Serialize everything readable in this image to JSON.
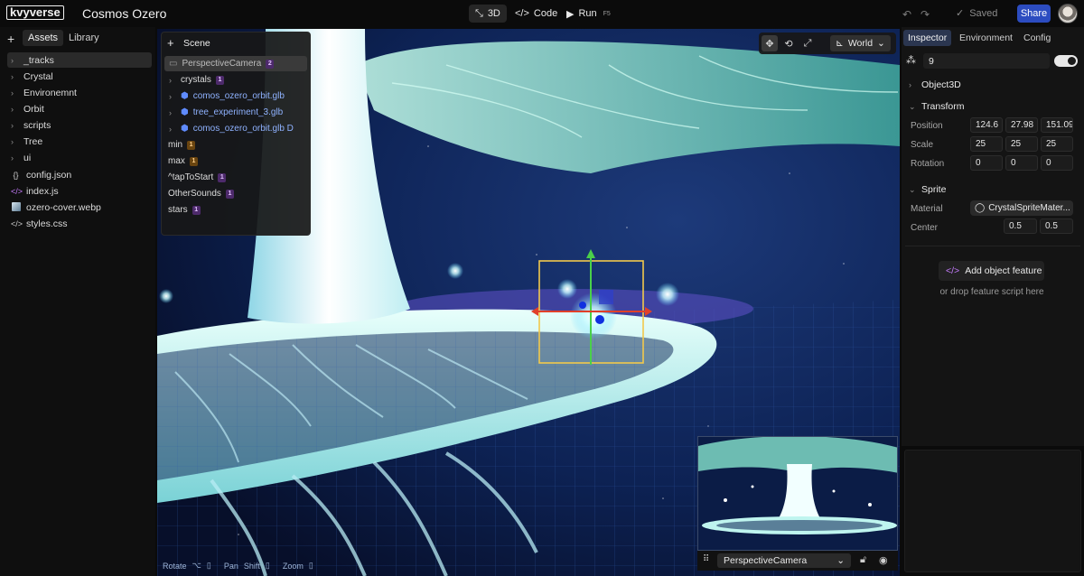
{
  "app": {
    "logo": "kvyverse",
    "project_title": "Cosmos Ozero"
  },
  "toolbar": {
    "mode_3d": "3D",
    "mode_code": "Code",
    "run": "Run",
    "run_shortcut": "F5",
    "saved": "Saved",
    "share": "Share"
  },
  "sidebar": {
    "tabs": [
      "Assets",
      "Library"
    ],
    "items": [
      {
        "label": "_tracks",
        "type": "folder"
      },
      {
        "label": "Crystal",
        "type": "folder"
      },
      {
        "label": "Environemnt",
        "type": "folder"
      },
      {
        "label": "Orbit",
        "type": "folder"
      },
      {
        "label": "scripts",
        "type": "folder"
      },
      {
        "label": "Tree",
        "type": "folder"
      },
      {
        "label": "ui",
        "type": "folder"
      },
      {
        "label": "config.json",
        "type": "json"
      },
      {
        "label": "index.js",
        "type": "js"
      },
      {
        "label": "ozero-cover.webp",
        "type": "image"
      },
      {
        "label": "styles.css",
        "type": "css"
      }
    ]
  },
  "scene": {
    "title": "Scene",
    "items": [
      {
        "label": "PerspectiveCamera",
        "badge": "2"
      },
      {
        "label": "crystals",
        "badge": "1"
      },
      {
        "label": "comos_ozero_orbit.glb"
      },
      {
        "label": "tree_experiment_3.glb"
      },
      {
        "label": "comos_ozero_orbit.glb D"
      },
      {
        "label": "min",
        "badge": "1"
      },
      {
        "label": "max",
        "badge": "1"
      },
      {
        "label": "^tapToStart",
        "badge": "1"
      },
      {
        "label": "OtherSounds",
        "badge": "1"
      },
      {
        "label": "stars",
        "badge": "1"
      }
    ]
  },
  "viewport": {
    "space": "World",
    "hints": {
      "rotate": "Rotate",
      "pan": "Pan",
      "pan_key": "Shift",
      "zoom": "Zoom"
    },
    "preview_camera": "PerspectiveCamera"
  },
  "inspector": {
    "tabs": [
      "Inspector",
      "Environment",
      "Config"
    ],
    "object_name": "9",
    "sections": {
      "object3d": "Object3D",
      "transform": "Transform",
      "sprite": "Sprite"
    },
    "transform": {
      "position_label": "Position",
      "position": [
        "124.6",
        "27.98",
        "151.09"
      ],
      "scale_label": "Scale",
      "scale": [
        "25",
        "25",
        "25"
      ],
      "rotation_label": "Rotation",
      "rotation": [
        "0",
        "0",
        "0"
      ]
    },
    "sprite": {
      "material_label": "Material",
      "material": "CrystalSpriteMater...",
      "center_label": "Center",
      "center": [
        "0.5",
        "0.5"
      ]
    },
    "add_feature": "Add object feature",
    "drop_hint": "or drop feature script here"
  },
  "colors": {
    "accent": "#2c4cc0",
    "panel": "#141414",
    "selection": "#2b3650"
  }
}
